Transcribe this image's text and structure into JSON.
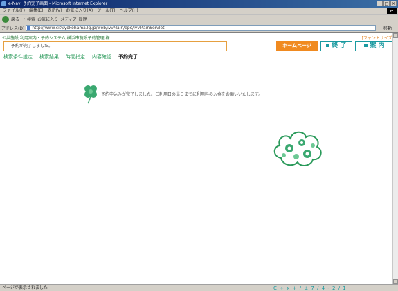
{
  "window": {
    "title": "e-Navi 予約完了画面 - Microsoft Internet Explorer",
    "controls": [
      "_",
      "□",
      "×"
    ]
  },
  "menu": {
    "items": [
      "ファイル(F)",
      "編集(E)",
      "表示(V)",
      "お気に入り(A)",
      "ツール(T)",
      "ヘルプ(H)"
    ]
  },
  "toolbar": {
    "items": [
      "戻る",
      "→",
      "検索",
      "お気に入り",
      "メディア",
      "履歴"
    ]
  },
  "address": {
    "label": "アドレス(D)",
    "url": "http://www.city.yokohama.lg.jp/web/ivvMain/epc/IvvMainServlet",
    "go_label": "移動"
  },
  "page": {
    "breadcrumb": "公共施設 利用案内・予約システム 横浜市施設予約管理 様",
    "font_size_link": "[フォントサイズ]",
    "message": "予約が完了しました。",
    "buttons": {
      "homepage": "ホームページ",
      "finish": "終 了",
      "guide": "案 内"
    },
    "steps": [
      "検索条件設定",
      "検索結果",
      "時間指定",
      "内容確認",
      "予約完了"
    ],
    "current_step_index": 4,
    "notice": "予約申込みが完了しました。ご利用日の当日までに利用料の入金をお願いいたします。"
  },
  "status": {
    "text": "ページが表示されました",
    "ruler": "C ÷ x + / ± 7 / 4 - 2 / 1"
  },
  "colors": {
    "accent": "#1a9aa0",
    "orange": "#f08a20",
    "green": "#2a9a5a"
  }
}
